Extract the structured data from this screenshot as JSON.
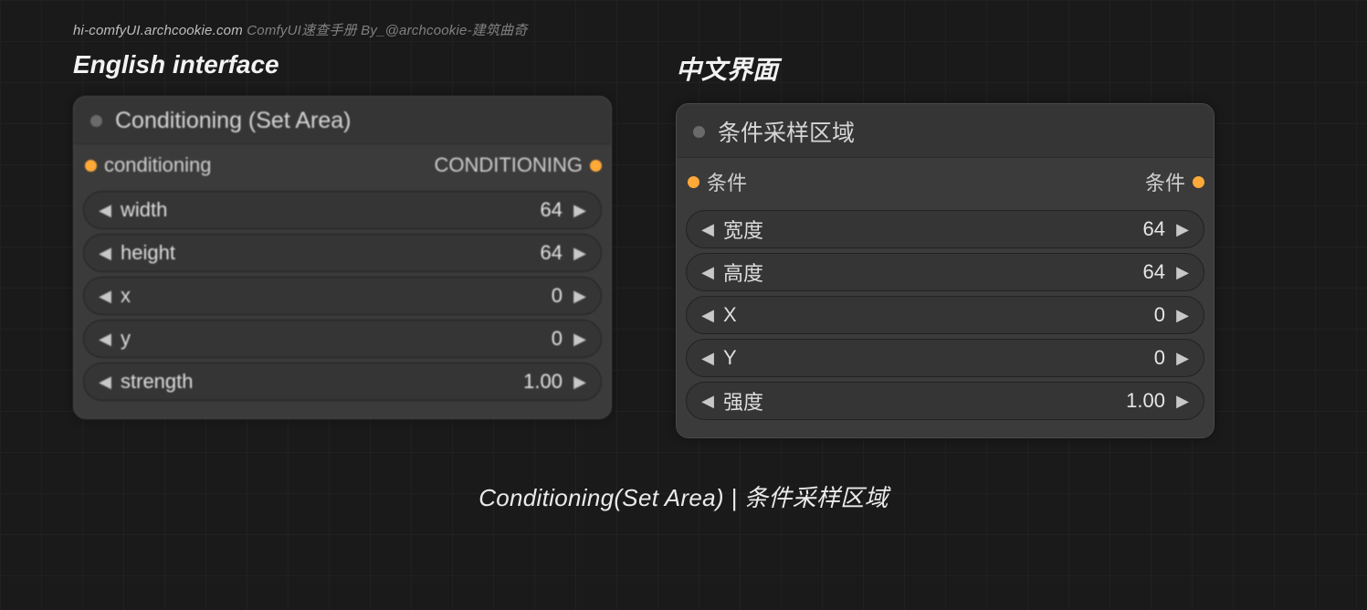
{
  "credit": {
    "site": "hi-comfyUI.archcookie.com",
    "rest": " ComfyUI速查手册 By_@archcookie-建筑曲奇"
  },
  "left": {
    "heading": "English interface",
    "node_title": "Conditioning (Set Area)",
    "input_label": "conditioning",
    "output_label": "CONDITIONING",
    "params": [
      {
        "label": "width",
        "value": "64"
      },
      {
        "label": "height",
        "value": "64"
      },
      {
        "label": "x",
        "value": "0"
      },
      {
        "label": "y",
        "value": "0"
      },
      {
        "label": "strength",
        "value": "1.00"
      }
    ]
  },
  "right": {
    "heading": "中文界面",
    "node_title": "条件采样区域",
    "input_label": "条件",
    "output_label": "条件",
    "params": [
      {
        "label": "宽度",
        "value": "64"
      },
      {
        "label": "高度",
        "value": "64"
      },
      {
        "label": "X",
        "value": "0"
      },
      {
        "label": "Y",
        "value": "0"
      },
      {
        "label": "强度",
        "value": "1.00"
      }
    ]
  },
  "footer": "Conditioning(Set Area) | 条件采样区域"
}
